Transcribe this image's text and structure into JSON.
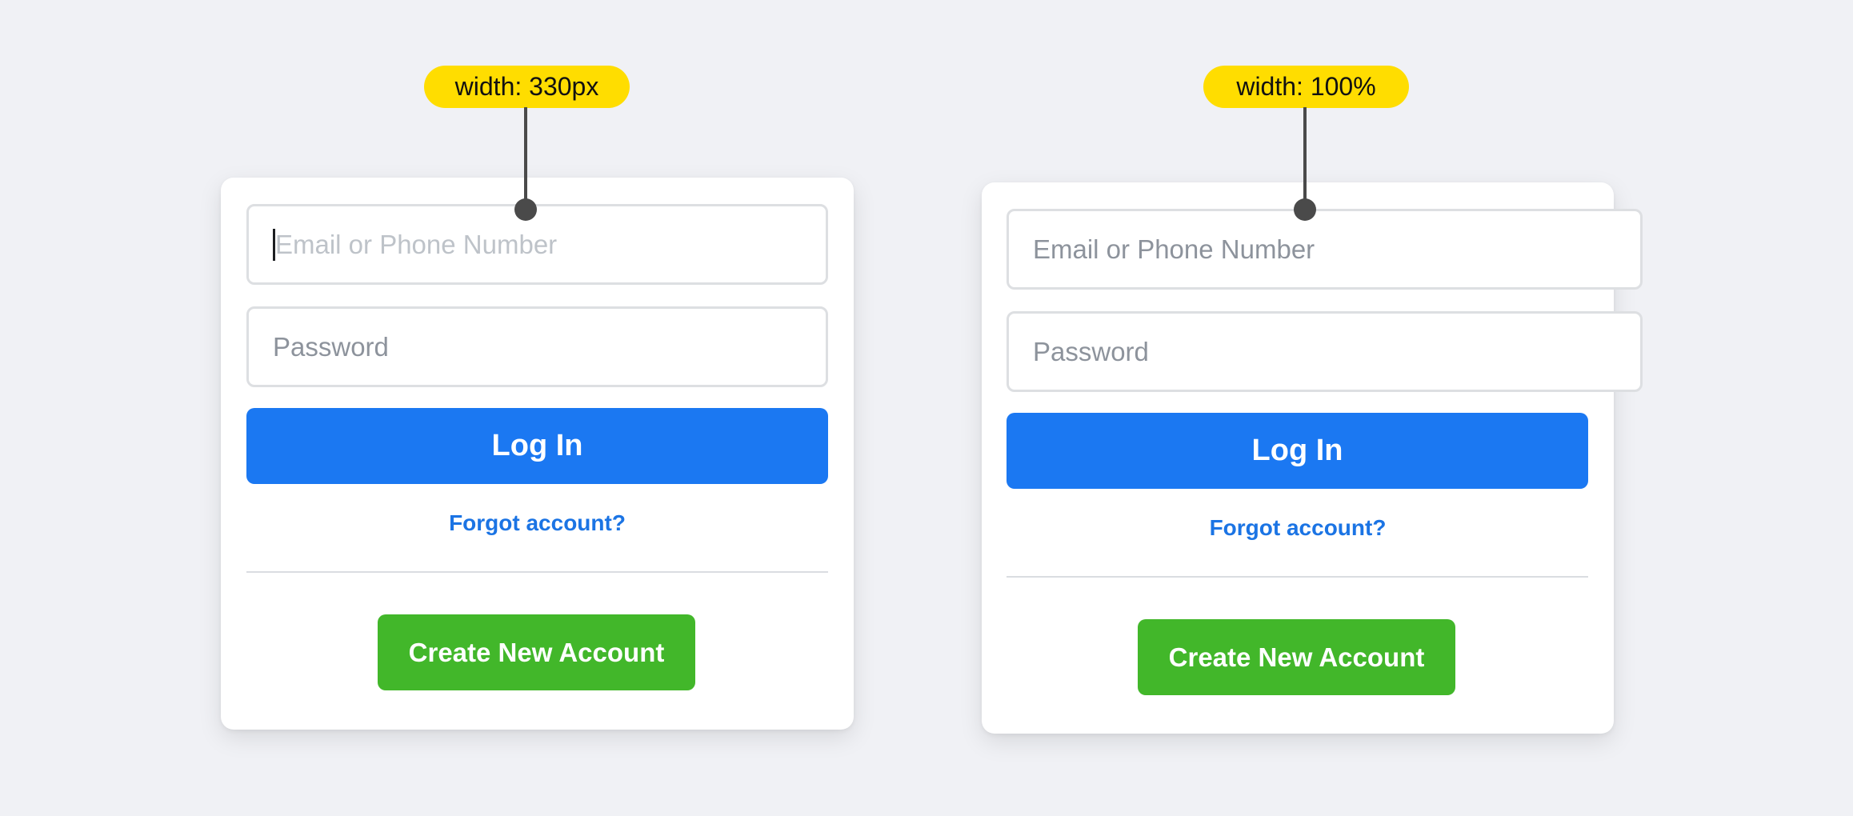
{
  "annotations": {
    "left": {
      "label": "width: 330px"
    },
    "right": {
      "label": "width: 100%"
    }
  },
  "forms": {
    "left": {
      "email_placeholder": "Email or Phone Number",
      "email_focused": true,
      "password_placeholder": "Password",
      "login_label": "Log In",
      "forgot_label": "Forgot account?",
      "create_label": "Create New Account"
    },
    "right": {
      "email_placeholder": "Email or Phone Number",
      "email_focused": false,
      "password_placeholder": "Password",
      "login_label": "Log In",
      "forgot_label": "Forgot account?",
      "create_label": "Create New Account"
    }
  },
  "colors": {
    "background": "#f0f1f5",
    "tag": "#ffdd00",
    "login": "#1b78f2",
    "link": "#1b74e4",
    "create": "#42b72a",
    "connector": "#4a4a4a"
  }
}
